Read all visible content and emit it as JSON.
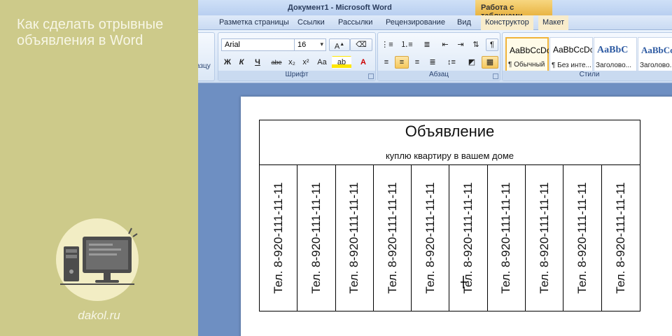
{
  "promo": {
    "title": "Как сделать отрывные объявления в Word",
    "site": "dakol.ru"
  },
  "word": {
    "window_title": "Документ1 - Microsoft Word",
    "context_title": "Работа с таблицами",
    "tabs": [
      "Разметка страницы",
      "Ссылки",
      "Рассылки",
      "Рецензирование",
      "Вид",
      "Конструктор",
      "Макет"
    ],
    "left_group_fragment": "азцу",
    "font": {
      "name": "Arial",
      "size": "16",
      "group_label": "Шрифт",
      "buttons": [
        "Ж",
        "К",
        "Ч",
        "abe",
        "x₂",
        "x²",
        "Aa"
      ]
    },
    "paragraph": {
      "group_label": "Абзац"
    },
    "styles": {
      "group_label": "Стили",
      "items": [
        {
          "sample": "AaBbCcDc",
          "name": "¶ Обычный"
        },
        {
          "sample": "AaBbCcDc",
          "name": "¶ Без инте..."
        },
        {
          "sample": "AaBbC",
          "name": "Заголово..."
        },
        {
          "sample": "AaBbCc",
          "name": "Заголово..."
        }
      ]
    }
  },
  "document": {
    "title": "Объявление",
    "subtitle": "куплю квартиру в вашем доме",
    "strips": [
      "Тел. 8-920-111-11-11",
      "Тел. 8-920-111-11-11",
      "Тел. 8-920-111-11-11",
      "Тел. 8-920-111-11-11",
      "Тел. 8-920-111-11-11",
      "Тел. 8-920-111-11-11",
      "Тел. 8-920-111-11-11",
      "Тел. 8-920-111-11-11",
      "Тел. 8-920-111-11-11",
      "Тел. 8-920-111-11-11"
    ]
  },
  "colors": {
    "promo_bg": "#cdca8a",
    "word_bg": "#6e8fc2",
    "context_tab": "#f5c75d"
  }
}
